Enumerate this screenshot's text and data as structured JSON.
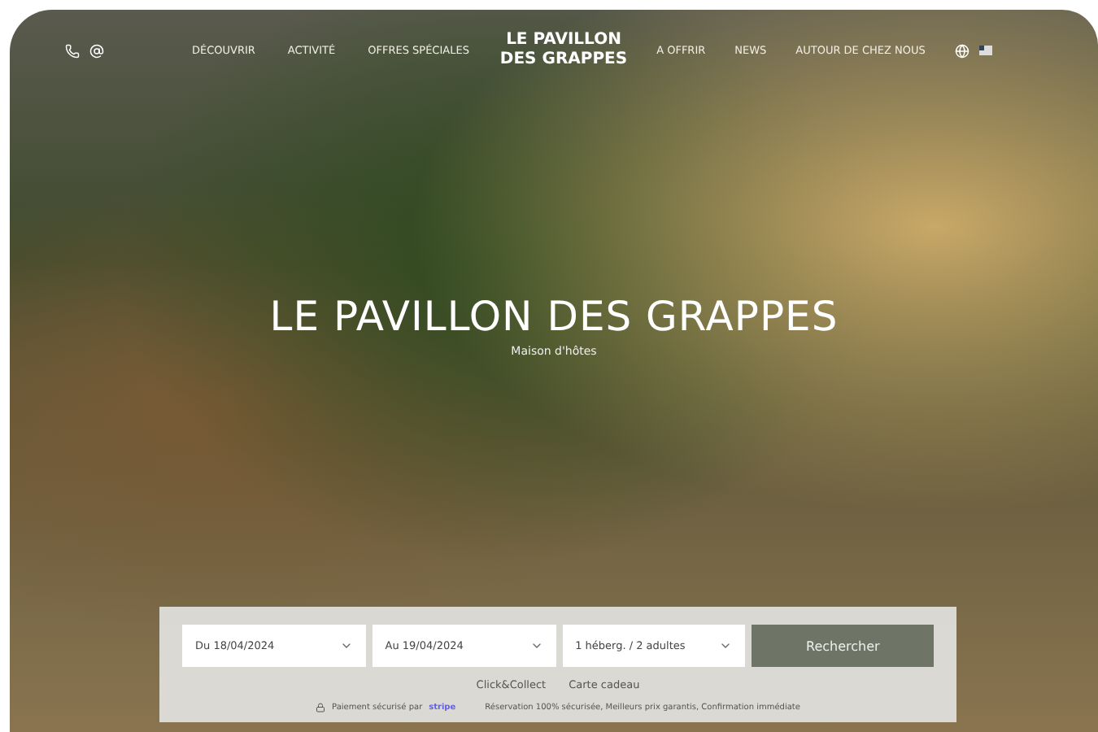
{
  "nav": {
    "left": [
      "DÉCOUVRIR",
      "ACTIVITÉ",
      "OFFRES SPÉCIALES"
    ],
    "logo": [
      "LE PAVILLON",
      "DES GRAPPES"
    ],
    "right": [
      "A OFFRIR",
      "NEWS",
      "AUTOUR DE CHEZ NOUS"
    ]
  },
  "hero": {
    "title": "LE PAVILLON DES GRAPPES",
    "subtitle": "Maison d'hôtes"
  },
  "booking": {
    "fields": [
      {
        "value": "Du 18/04/2024"
      },
      {
        "value": "Au 19/04/2024"
      },
      {
        "value": "1 héberg. / 2 adultes"
      }
    ],
    "button": "Rechercher",
    "links": [
      "Click&Collect",
      "Carte cadeau"
    ],
    "payment": "Paiement sécurisé par",
    "payment_brand": "stripe",
    "guarantees": "Réservation 100% sécurisée, Meilleurs prix garantis, Confirmation immédiate"
  }
}
